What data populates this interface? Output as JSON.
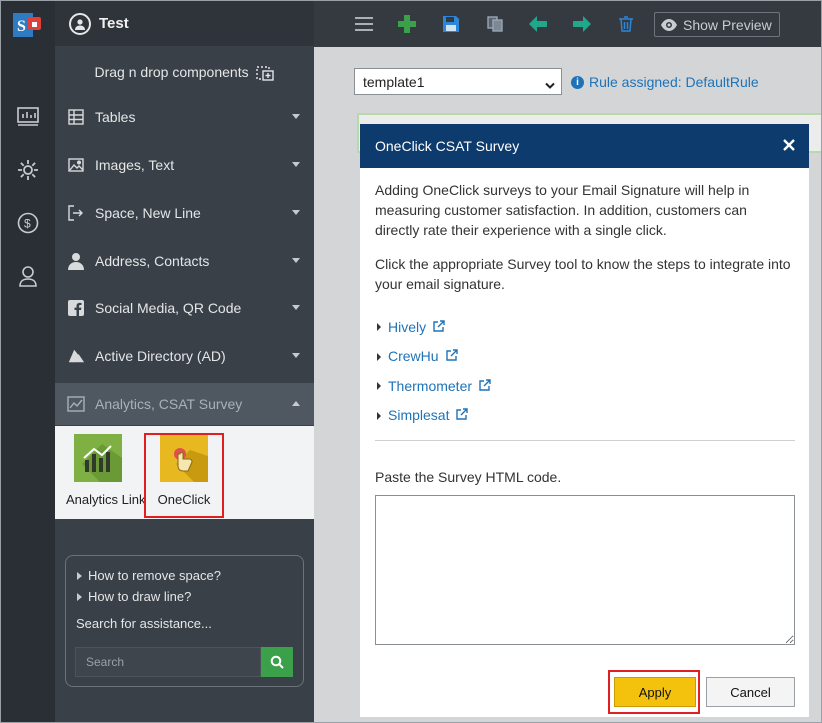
{
  "sidebar": {
    "title": "Test",
    "dnd_label": "Drag n drop components",
    "sections": [
      {
        "label": "Tables",
        "icon": "table-icon"
      },
      {
        "label": "Images, Text",
        "icon": "image-icon"
      },
      {
        "label": "Space, New Line",
        "icon": "space-icon"
      },
      {
        "label": "Address, Contacts",
        "icon": "contact-icon"
      },
      {
        "label": "Social Media, QR Code",
        "icon": "facebook-icon"
      },
      {
        "label": "Active Directory (AD)",
        "icon": "azure-icon"
      },
      {
        "label": "Analytics, CSAT Survey",
        "icon": "analytics-icon"
      }
    ],
    "tiles": [
      {
        "label": "Analytics Link",
        "icon": "analytics-link-icon"
      },
      {
        "label": "OneClick",
        "icon": "oneclick-icon"
      }
    ],
    "help": {
      "links": [
        "How to remove space?",
        "How to draw line?"
      ],
      "label": "Search for assistance...",
      "search_placeholder": "Search"
    }
  },
  "toolbar": {
    "preview_label": "Show Preview"
  },
  "template": {
    "selected": "template1",
    "rule_text": "Rule assigned: DefaultRule"
  },
  "modal": {
    "title": "OneClick CSAT Survey",
    "paragraph1": "Adding OneClick surveys to your Email Signature will help in measuring customer satisfaction. In addition, customers can directly rate their experience with a single click.",
    "paragraph2": "Click the appropriate Survey tool to know the steps to integrate into your email signature.",
    "survey_tools": [
      "Hively",
      "CrewHu",
      "Thermometer",
      "Simplesat"
    ],
    "paste_label": "Paste the Survey HTML code.",
    "apply_label": "Apply",
    "cancel_label": "Cancel"
  },
  "colors": {
    "rail": "#2a2f35",
    "sidebar": "#3a4047",
    "toolbar": "#353a40",
    "modal_header": "#0d3b6e",
    "link": "#1e73b8",
    "apply": "#f4c20d",
    "highlight": "#e02020",
    "add_icon": "#3aa14a",
    "arrow_icon": "#1fa88a"
  }
}
